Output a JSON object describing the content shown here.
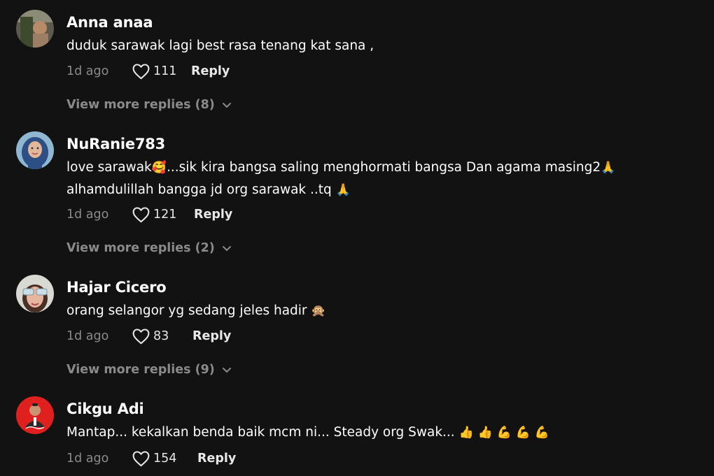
{
  "colors": {
    "background": "#121212",
    "username": "#ffffff",
    "muted": "#8a8a8a",
    "reply": "#e8e8e8"
  },
  "icons": {
    "like": "heart-outline-icon",
    "expand": "chevron-down-icon"
  },
  "comments": [
    {
      "username": "Anna anaa",
      "text_parts": [
        "duduk sarawak lagi best rasa tenang kat sana ,"
      ],
      "time": "1d ago",
      "likes": "111",
      "reply_label": "Reply",
      "more_replies": "View more replies (8)"
    },
    {
      "username": "NuRanie783",
      "text_parts": [
        "love sarawak",
        "🥰",
        "...sik kira bangsa saling menghormati bangsa Dan agama masing2",
        "🙏",
        "alhamdulillah bangga jd org sarawak ..tq ",
        "🙏"
      ],
      "time": "1d ago",
      "likes": "121",
      "reply_label": "Reply",
      "more_replies": "View more replies (2)"
    },
    {
      "username": "Hajar Cicero",
      "text_parts": [
        "orang selangor yg sedang jeles hadir ",
        "🙊"
      ],
      "time": "1d ago",
      "likes": "83",
      "reply_label": "Reply",
      "more_replies": "View more replies (9)"
    },
    {
      "username": "Cikgu Adi",
      "text_parts": [
        "Mantap... kekalkan benda baik mcm ni... Steady org Swak... ",
        "👍",
        "👍",
        "💪",
        "💪",
        "💪"
      ],
      "time": "1d ago",
      "likes": "154",
      "reply_label": "Reply"
    }
  ]
}
